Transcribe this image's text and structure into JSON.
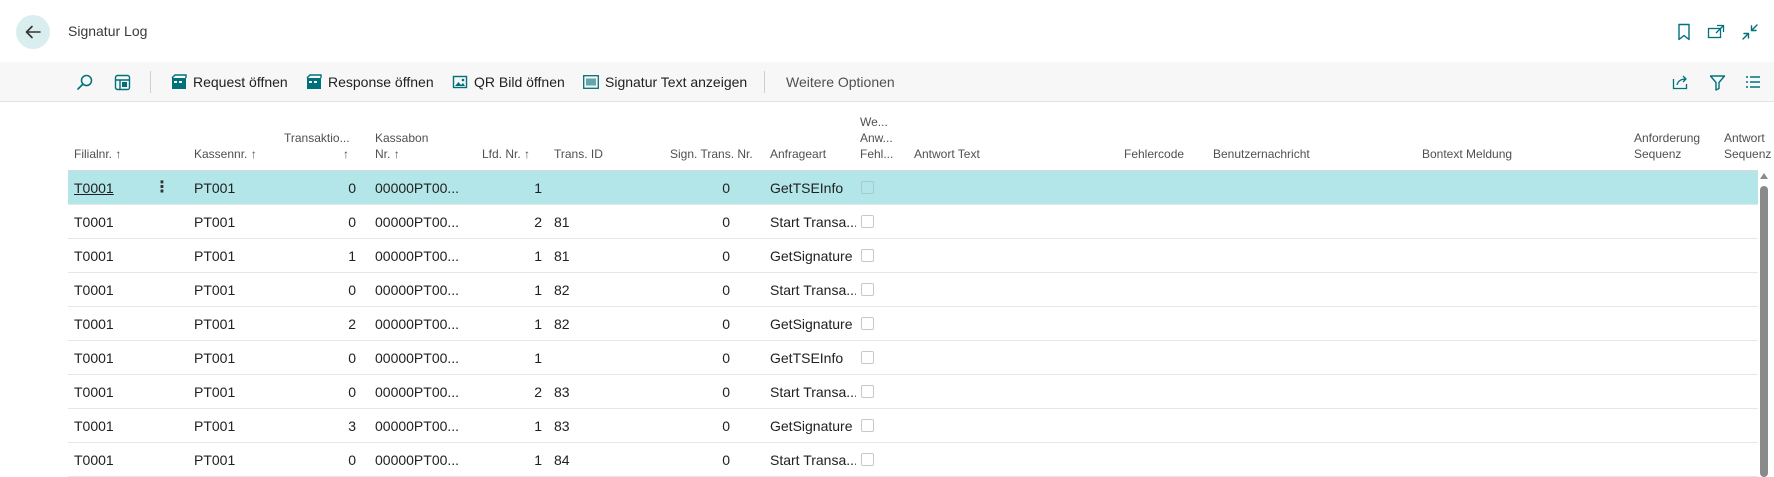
{
  "page": {
    "title": "Signatur Log"
  },
  "actions": {
    "request": "Request öffnen",
    "response": "Response öffnen",
    "qr": "QR Bild öffnen",
    "signatur_text": "Signatur Text anzeigen",
    "more": "Weitere Optionen"
  },
  "columns": {
    "filialnr": "Filialnr.",
    "kassennr": "Kassennr.",
    "transaktion": "Transaktio...",
    "kassabon_1": "Kassabon",
    "kassabon_2": "Nr.",
    "lfd_nr": "Lfd. Nr.",
    "trans_id": "Trans. ID",
    "sign_trans_nr": "Sign. Trans. Nr.",
    "anfrageart": "Anfrageart",
    "we_1": "We...",
    "we_2": "Anw...",
    "we_3": "Fehl...",
    "antwort_text": "Antwort Text",
    "fehlercode": "Fehlercode",
    "benutzernachricht": "Benutzernachricht",
    "bontext": "Bontext Meldung",
    "anf_seq_1": "Anforderung",
    "anf_seq_2": "Sequenz",
    "ant_seq_1": "Antwort",
    "ant_seq_2": "Sequenz",
    "sort_arrow": "↑"
  },
  "rows": [
    {
      "filialnr": "T0001",
      "kassennr": "PT001",
      "transaktion": "0",
      "kassabon": "00000PT00...",
      "lfd_nr": "1",
      "trans_id": "",
      "sign_trans_nr": "0",
      "anfrageart": "GetTSEInfo",
      "checked": false,
      "selected": true
    },
    {
      "filialnr": "T0001",
      "kassennr": "PT001",
      "transaktion": "0",
      "kassabon": "00000PT00...",
      "lfd_nr": "2",
      "trans_id": "81",
      "sign_trans_nr": "0",
      "anfrageart": "Start Transa...",
      "checked": false
    },
    {
      "filialnr": "T0001",
      "kassennr": "PT001",
      "transaktion": "1",
      "kassabon": "00000PT00...",
      "lfd_nr": "1",
      "trans_id": "81",
      "sign_trans_nr": "0",
      "anfrageart": "GetSignature",
      "checked": false
    },
    {
      "filialnr": "T0001",
      "kassennr": "PT001",
      "transaktion": "0",
      "kassabon": "00000PT00...",
      "lfd_nr": "1",
      "trans_id": "82",
      "sign_trans_nr": "0",
      "anfrageart": "Start Transa...",
      "checked": false
    },
    {
      "filialnr": "T0001",
      "kassennr": "PT001",
      "transaktion": "2",
      "kassabon": "00000PT00...",
      "lfd_nr": "1",
      "trans_id": "82",
      "sign_trans_nr": "0",
      "anfrageart": "GetSignature",
      "checked": false
    },
    {
      "filialnr": "T0001",
      "kassennr": "PT001",
      "transaktion": "0",
      "kassabon": "00000PT00...",
      "lfd_nr": "1",
      "trans_id": "",
      "sign_trans_nr": "0",
      "anfrageart": "GetTSEInfo",
      "checked": false
    },
    {
      "filialnr": "T0001",
      "kassennr": "PT001",
      "transaktion": "0",
      "kassabon": "00000PT00...",
      "lfd_nr": "2",
      "trans_id": "83",
      "sign_trans_nr": "0",
      "anfrageart": "Start Transa...",
      "checked": false
    },
    {
      "filialnr": "T0001",
      "kassennr": "PT001",
      "transaktion": "3",
      "kassabon": "00000PT00...",
      "lfd_nr": "1",
      "trans_id": "83",
      "sign_trans_nr": "0",
      "anfrageart": "GetSignature",
      "checked": false
    },
    {
      "filialnr": "T0001",
      "kassennr": "PT001",
      "transaktion": "0",
      "kassabon": "00000PT00...",
      "lfd_nr": "1",
      "trans_id": "84",
      "sign_trans_nr": "0",
      "anfrageart": "Start Transa...",
      "checked": false
    }
  ],
  "colors": {
    "accent": "#00707a",
    "selected_row": "#b3e6e9",
    "back_button": "#daeef0"
  },
  "icons": {
    "back": "arrow-left-icon",
    "bookmark": "bookmark-icon",
    "open_new": "open-in-new-window-icon",
    "collapse": "collapse-icon",
    "search": "search-icon",
    "layout": "layout-icon",
    "request": "document-film-icon",
    "response": "document-film-icon",
    "qr": "image-icon",
    "signatur": "barcode-icon",
    "share": "share-icon",
    "filter": "filter-icon",
    "list": "list-view-icon"
  }
}
